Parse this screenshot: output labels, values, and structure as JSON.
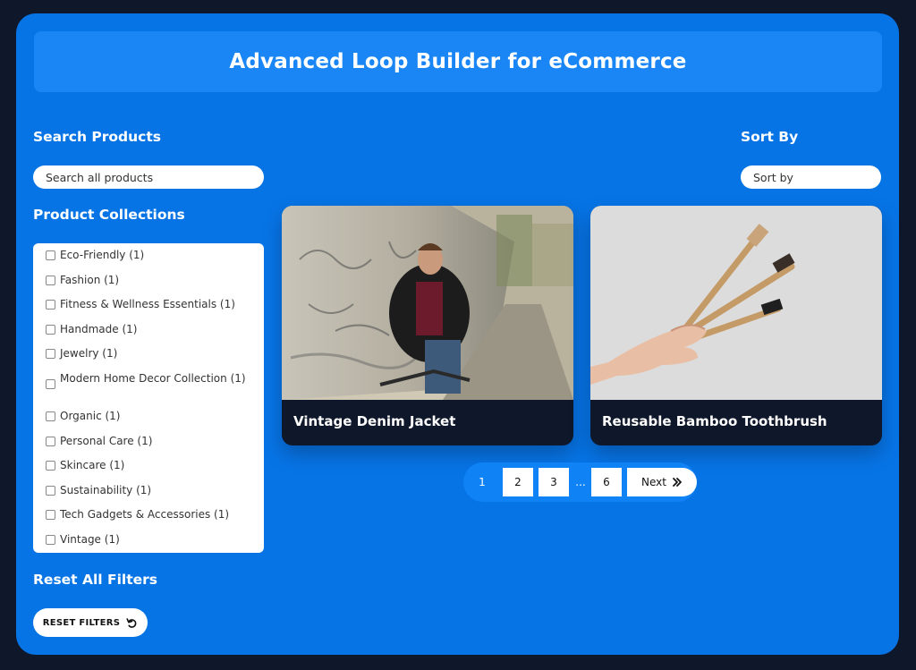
{
  "header": {
    "title": "Advanced Loop Builder for eCommerce"
  },
  "search": {
    "title": "Search Products",
    "placeholder": "Search all products"
  },
  "sort": {
    "title": "Sort By",
    "placeholder": "Sort by"
  },
  "collections": {
    "title": "Product Collections",
    "items": [
      {
        "label": "Eco-Friendly (1)"
      },
      {
        "label": "Fashion (1)"
      },
      {
        "label": "Fitness & Wellness Essentials (1)"
      },
      {
        "label": "Handmade (1)"
      },
      {
        "label": "Jewelry (1)"
      },
      {
        "label": "Modern Home Decor Collection (1)"
      },
      {
        "label": "Organic (1)"
      },
      {
        "label": "Personal Care (1)"
      },
      {
        "label": "Skincare (1)"
      },
      {
        "label": "Sustainability (1)"
      },
      {
        "label": "Tech Gadgets & Accessories (1)"
      },
      {
        "label": "Vintage (1)"
      }
    ]
  },
  "reset": {
    "title": "Reset All Filters",
    "button_label": "RESET FILTERS",
    "icon": "undo-icon"
  },
  "products": [
    {
      "title": "Vintage Denim Jacket"
    },
    {
      "title": "Reusable Bamboo Toothbrush"
    }
  ],
  "pagination": {
    "current": "1",
    "pages": [
      "2",
      "3",
      "6"
    ],
    "ellipsis": "...",
    "next_label": "Next",
    "next_icon": "double-chevron-right-icon"
  },
  "colors": {
    "page_bg": "#0f172a",
    "panel_bg": "#0774e6",
    "hero_bg": "#1a86f5",
    "card_footer": "#0f172a"
  }
}
